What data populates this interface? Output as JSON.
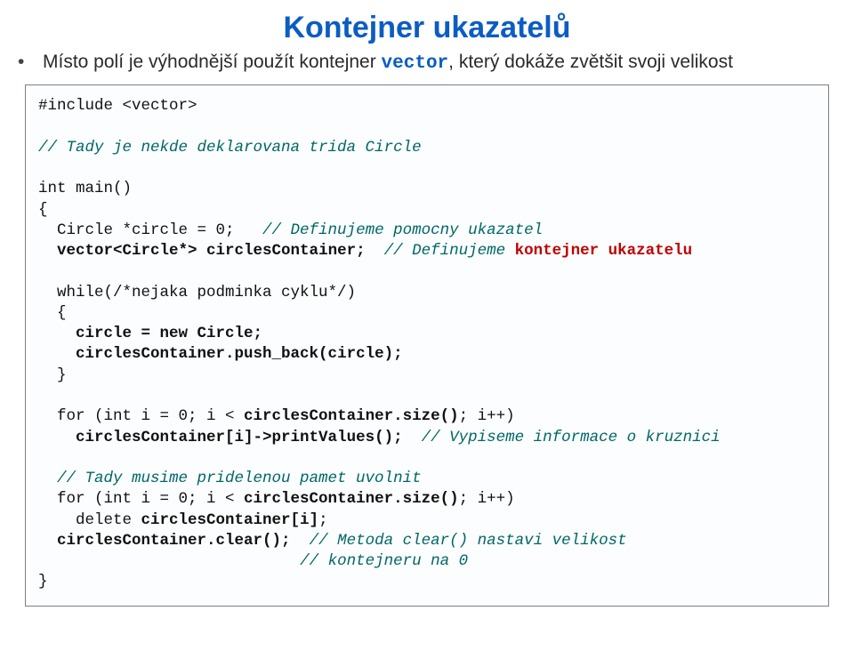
{
  "title": "Kontejner ukazatelů",
  "intro_pre": "Místo polí je výhodnější použít kontejner ",
  "intro_code": "vector",
  "intro_post": ", který dokáže zvětšit svoji velikost",
  "code": {
    "l1": "#include <vector>",
    "l2": "// Tady je nekde deklarovana trida Circle",
    "l3": "int main()",
    "l4": "{",
    "l5a": "  Circle *circle = 0;   ",
    "l5b": "// Definujeme pomocny ukazatel",
    "l6a": "  ",
    "l6b": "vector<Circle*> circlesContainer;",
    "l6c": "  ",
    "l6d": "// Definujeme ",
    "l6e": "kontejner ukazatelu",
    "l7": "  while(/*nejaka podminka cyklu*/)",
    "l8": "  {",
    "l9a": "    ",
    "l9b": "circle = new Circle;",
    "l10a": "    ",
    "l10b": "circlesContainer.push_back(circle);",
    "l11": "  }",
    "l12a": "  for (int i = 0; i < ",
    "l12b": "circlesContainer.size()",
    "l12c": "; i++)",
    "l13a": "    ",
    "l13b": "circlesContainer[i]->printValues();",
    "l13c": "  ",
    "l13d": "// Vypiseme informace o kruznici",
    "l14": "  // Tady musime pridelenou pamet uvolnit",
    "l15a": "  for (int i = 0; i < ",
    "l15b": "circlesContainer.size()",
    "l15c": "; i++)",
    "l16a": "    delete ",
    "l16b": "circlesContainer[i]",
    "l16c": ";",
    "l17a": "  ",
    "l17b": "circlesContainer.clear();",
    "l17c": "  ",
    "l17d": "// Metoda clear() nastavi velikost",
    "l18a": "                            ",
    "l18b": "// kontejneru na 0",
    "l19": "}"
  }
}
